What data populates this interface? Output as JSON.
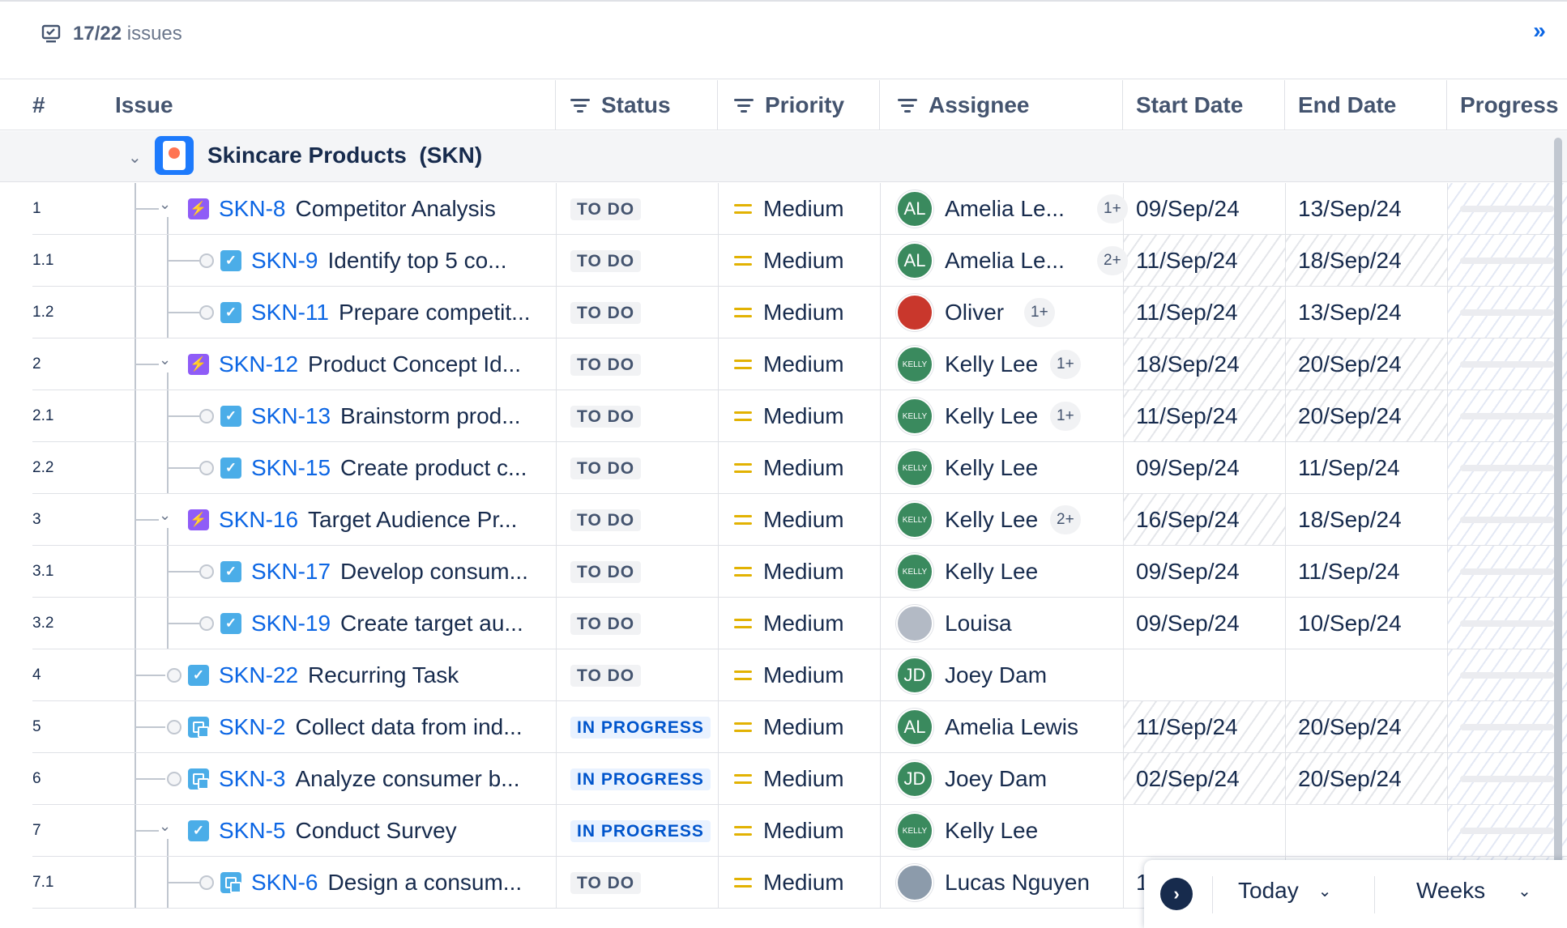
{
  "toolbar": {
    "count": "17/22",
    "count_suffix": "issues",
    "expand_label": "»"
  },
  "columns": {
    "num": "#",
    "issue": "Issue",
    "status": "Status",
    "priority": "Priority",
    "assignee": "Assignee",
    "start": "Start Date",
    "end": "End Date",
    "progress": "Progress"
  },
  "group": {
    "title": "Skincare Products  (SKN)",
    "chevron": "⌄"
  },
  "rows": [
    {
      "num": "1",
      "key": "SKN-8",
      "summary": "Competitor Analysis",
      "type": "epic",
      "status": "TO DO",
      "priority": "Medium",
      "assignee": "Amelia Le...",
      "avatar": "AL",
      "extra": "1+",
      "start": "09/Sep/24",
      "end": "13/Sep/24"
    },
    {
      "num": "1.1",
      "key": "SKN-9",
      "summary": "Identify top 5 co...",
      "type": "task",
      "status": "TO DO",
      "priority": "Medium",
      "assignee": "Amelia Le...",
      "avatar": "AL",
      "extra": "2+",
      "start": "11/Sep/24",
      "end": "18/Sep/24"
    },
    {
      "num": "1.2",
      "key": "SKN-11",
      "summary": "Prepare competit...",
      "type": "task",
      "status": "TO DO",
      "priority": "Medium",
      "assignee": "Oliver",
      "avatar": "",
      "extra": "1+",
      "start": "11/Sep/24",
      "end": "13/Sep/24"
    },
    {
      "num": "2",
      "key": "SKN-12",
      "summary": "Product Concept Id...",
      "type": "epic",
      "status": "TO DO",
      "priority": "Medium",
      "assignee": "Kelly Lee",
      "avatar": "KELLY",
      "extra": "1+",
      "start": "18/Sep/24",
      "end": "20/Sep/24"
    },
    {
      "num": "2.1",
      "key": "SKN-13",
      "summary": "Brainstorm prod...",
      "type": "task",
      "status": "TO DO",
      "priority": "Medium",
      "assignee": "Kelly Lee",
      "avatar": "KELLY",
      "extra": "1+",
      "start": "11/Sep/24",
      "end": "20/Sep/24"
    },
    {
      "num": "2.2",
      "key": "SKN-15",
      "summary": "Create product c...",
      "type": "task",
      "status": "TO DO",
      "priority": "Medium",
      "assignee": "Kelly Lee",
      "avatar": "KELLY",
      "extra": "",
      "start": "09/Sep/24",
      "end": "11/Sep/24"
    },
    {
      "num": "3",
      "key": "SKN-16",
      "summary": "Target Audience Pr...",
      "type": "epic",
      "status": "TO DO",
      "priority": "Medium",
      "assignee": "Kelly Lee",
      "avatar": "KELLY",
      "extra": "2+",
      "start": "16/Sep/24",
      "end": "18/Sep/24"
    },
    {
      "num": "3.1",
      "key": "SKN-17",
      "summary": "Develop consum...",
      "type": "task",
      "status": "TO DO",
      "priority": "Medium",
      "assignee": "Kelly Lee",
      "avatar": "KELLY",
      "extra": "",
      "start": "09/Sep/24",
      "end": "11/Sep/24"
    },
    {
      "num": "3.2",
      "key": "SKN-19",
      "summary": "Create target au...",
      "type": "task",
      "status": "TO DO",
      "priority": "Medium",
      "assignee": "Louisa",
      "avatar": "",
      "extra": "",
      "start": "09/Sep/24",
      "end": "10/Sep/24"
    },
    {
      "num": "4",
      "key": "SKN-22",
      "summary": "Recurring Task",
      "type": "task",
      "status": "TO DO",
      "priority": "Medium",
      "assignee": "Joey Dam",
      "avatar": "JD",
      "extra": "",
      "start": "",
      "end": ""
    },
    {
      "num": "5",
      "key": "SKN-2",
      "summary": "Collect data from ind...",
      "type": "sub",
      "status": "IN PROGRESS",
      "priority": "Medium",
      "assignee": "Amelia Lewis",
      "avatar": "AL",
      "extra": "",
      "start": "11/Sep/24",
      "end": "20/Sep/24"
    },
    {
      "num": "6",
      "key": "SKN-3",
      "summary": "Analyze consumer b...",
      "type": "sub",
      "status": "IN PROGRESS",
      "priority": "Medium",
      "assignee": "Joey Dam",
      "avatar": "JD",
      "extra": "",
      "start": "02/Sep/24",
      "end": "20/Sep/24"
    },
    {
      "num": "7",
      "key": "SKN-5",
      "summary": "Conduct Survey",
      "type": "task",
      "status": "IN PROGRESS",
      "priority": "Medium",
      "assignee": "Kelly Lee",
      "avatar": "KELLY",
      "extra": "",
      "start": "",
      "end": ""
    },
    {
      "num": "7.1",
      "key": "SKN-6",
      "summary": "Design a consum...",
      "type": "sub",
      "status": "TO DO",
      "priority": "Medium",
      "assignee": "Lucas Nguyen",
      "avatar": "",
      "extra": "",
      "start": "1",
      "end": ""
    }
  ],
  "footer": {
    "nav_icon": "›",
    "today": "Today",
    "weeks": "Weeks",
    "caret": "⌄"
  }
}
